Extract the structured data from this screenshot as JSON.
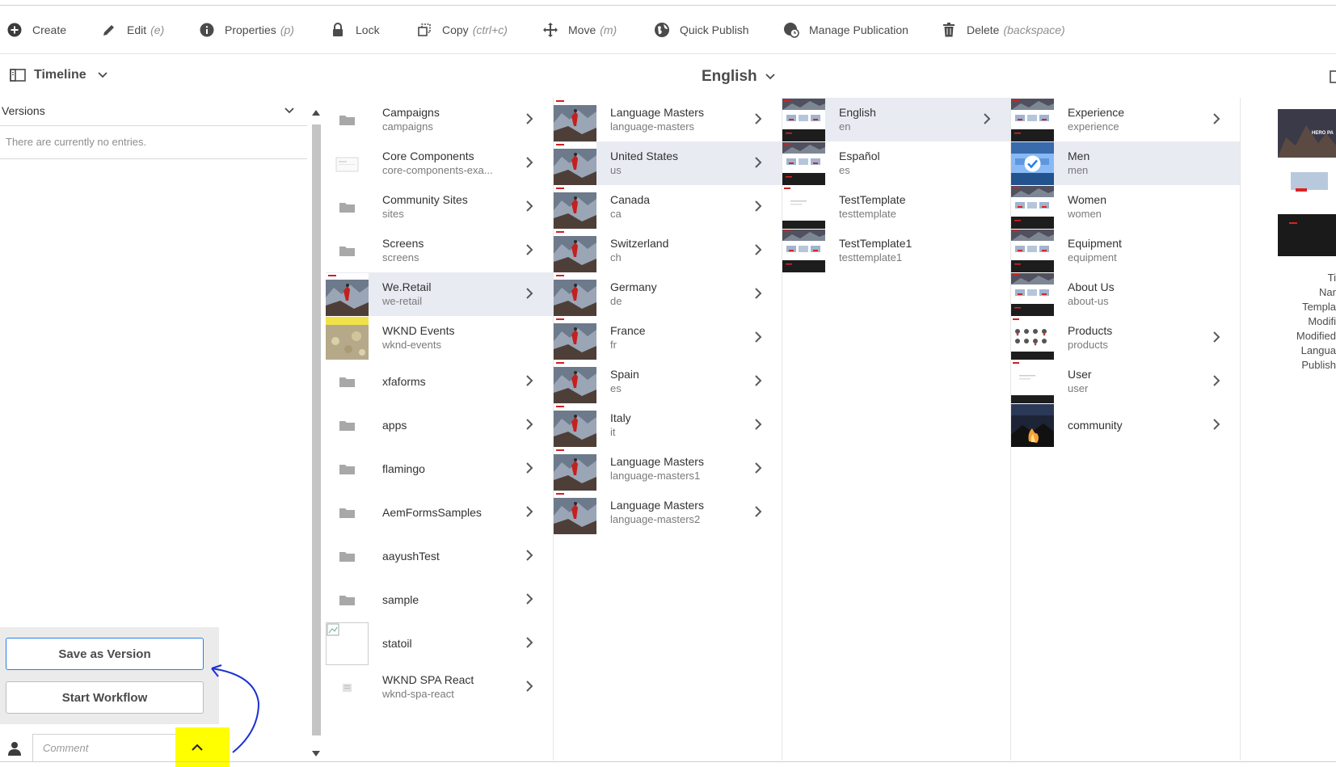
{
  "toolbar": {
    "create": {
      "label": "Create",
      "hint": ""
    },
    "edit": {
      "label": "Edit",
      "hint": "(e)"
    },
    "properties": {
      "label": "Properties",
      "hint": "(p)"
    },
    "lock": {
      "label": "Lock",
      "hint": ""
    },
    "copy": {
      "label": "Copy",
      "hint": "(ctrl+c)"
    },
    "move": {
      "label": "Move",
      "hint": "(m)"
    },
    "quick_publish": {
      "label": "Quick Publish",
      "hint": ""
    },
    "manage_publication": {
      "label": "Manage Publication",
      "hint": ""
    },
    "delete": {
      "label": "Delete",
      "hint": "(backspace)"
    }
  },
  "rail": {
    "mode_label": "Timeline",
    "filter_label": "Versions",
    "empty_text": "There are currently no entries.",
    "save_version_label": "Save as Version",
    "start_workflow_label": "Start Workflow",
    "comment_placeholder": "Comment"
  },
  "language_switch": "English",
  "columns": [
    [
      {
        "title": "Campaigns",
        "sub": "campaigns",
        "thumb": "folder",
        "arrow": true
      },
      {
        "title": "Core Components",
        "sub": "core-components-exa...",
        "thumb": "page-outline",
        "arrow": true
      },
      {
        "title": "Community Sites",
        "sub": "sites",
        "thumb": "folder",
        "arrow": true
      },
      {
        "title": "Screens",
        "sub": "screens",
        "thumb": "folder",
        "arrow": true
      },
      {
        "title": "We.Retail",
        "sub": "we-retail",
        "thumb": "mountain",
        "arrow": true,
        "selected": true
      },
      {
        "title": "WKND Events",
        "sub": "wknd-events",
        "thumb": "flowers",
        "arrow": false
      },
      {
        "title": "xfaforms",
        "sub": "",
        "thumb": "folder",
        "arrow": true
      },
      {
        "title": "apps",
        "sub": "",
        "thumb": "folder",
        "arrow": true
      },
      {
        "title": "flamingo",
        "sub": "",
        "thumb": "folder",
        "arrow": true
      },
      {
        "title": "AemFormsSamples",
        "sub": "",
        "thumb": "folder",
        "arrow": true
      },
      {
        "title": "aayushTest",
        "sub": "",
        "thumb": "folder",
        "arrow": true
      },
      {
        "title": "sample",
        "sub": "",
        "thumb": "folder",
        "arrow": true
      },
      {
        "title": "statoil",
        "sub": "",
        "thumb": "broken-image",
        "arrow": true
      },
      {
        "title": "WKND SPA React",
        "sub": "wknd-spa-react",
        "thumb": "small-page",
        "arrow": true
      }
    ],
    [
      {
        "title": "Language Masters",
        "sub": "language-masters",
        "thumb": "mountain",
        "arrow": true
      },
      {
        "title": "United States",
        "sub": "us",
        "thumb": "mountain",
        "arrow": true,
        "selected": true
      },
      {
        "title": "Canada",
        "sub": "ca",
        "thumb": "mountain",
        "arrow": true
      },
      {
        "title": "Switzerland",
        "sub": "ch",
        "thumb": "mountain",
        "arrow": true
      },
      {
        "title": "Germany",
        "sub": "de",
        "thumb": "mountain",
        "arrow": true
      },
      {
        "title": "France",
        "sub": "fr",
        "thumb": "mountain",
        "arrow": true
      },
      {
        "title": "Spain",
        "sub": "es",
        "thumb": "mountain",
        "arrow": true
      },
      {
        "title": "Italy",
        "sub": "it",
        "thumb": "mountain",
        "arrow": true
      },
      {
        "title": "Language Masters",
        "sub": "language-masters1",
        "thumb": "mountain",
        "arrow": true
      },
      {
        "title": "Language Masters",
        "sub": "language-masters2",
        "thumb": "mountain",
        "arrow": true
      }
    ],
    [
      {
        "title": "English",
        "sub": "en",
        "thumb": "site-page",
        "arrow": true,
        "selected": true
      },
      {
        "title": "Español",
        "sub": "es",
        "thumb": "site-page",
        "arrow": false
      },
      {
        "title": "TestTemplate",
        "sub": "testtemplate",
        "thumb": "white-page",
        "arrow": false
      },
      {
        "title": "TestTemplate1",
        "sub": "testtemplate1",
        "thumb": "site-page",
        "arrow": false
      }
    ],
    [
      {
        "title": "Experience",
        "sub": "experience",
        "thumb": "site-page",
        "arrow": true
      },
      {
        "title": "Men",
        "sub": "men",
        "thumb": "checked",
        "arrow": false,
        "selected": true
      },
      {
        "title": "Women",
        "sub": "women",
        "thumb": "site-page",
        "arrow": false
      },
      {
        "title": "Equipment",
        "sub": "equipment",
        "thumb": "site-page",
        "arrow": false
      },
      {
        "title": "About Us",
        "sub": "about-us",
        "thumb": "site-page",
        "arrow": false
      },
      {
        "title": "Products",
        "sub": "products",
        "thumb": "products",
        "arrow": true
      },
      {
        "title": "User",
        "sub": "user",
        "thumb": "white-page",
        "arrow": true
      },
      {
        "title": "community",
        "sub": "",
        "thumb": "fire",
        "arrow": true
      }
    ]
  ],
  "preview": {
    "badge_text": "HERO PA",
    "meta": [
      "Ti",
      "Nar",
      "Templa",
      "Modifi",
      "Modified",
      "Langua",
      "Publish"
    ]
  },
  "colors": {
    "accent": "#2680eb",
    "selected_row": "#e8ebf2",
    "highlight": "#ffff00",
    "annotation": "#1a2fd6"
  }
}
